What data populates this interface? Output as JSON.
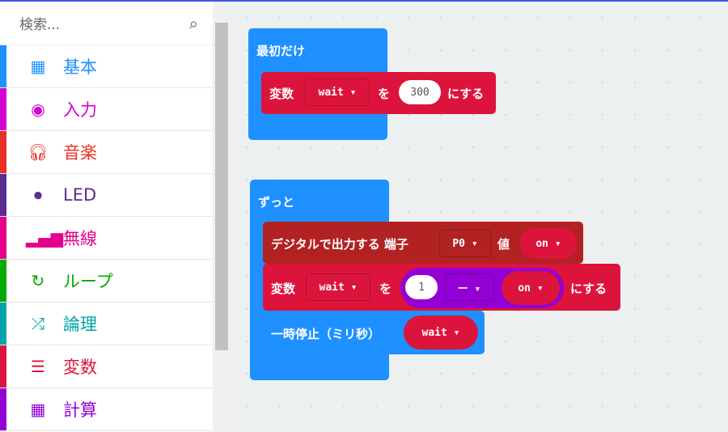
{
  "search": {
    "placeholder": "検索..."
  },
  "categories": [
    {
      "label": "基本",
      "icon": "grid-icon",
      "color": "#1e90ff"
    },
    {
      "label": "入力",
      "icon": "target-icon",
      "color": "#d400d4"
    },
    {
      "label": "音楽",
      "icon": "headphones-icon",
      "color": "#e63022"
    },
    {
      "label": "LED",
      "icon": "toggle-icon",
      "color": "#5c2d91"
    },
    {
      "label": "無線",
      "icon": "signal-icon",
      "color": "#e3008c"
    },
    {
      "label": "ループ",
      "icon": "refresh-icon",
      "color": "#00aa00"
    },
    {
      "label": "論理",
      "icon": "shuffle-icon",
      "color": "#00a4a6"
    },
    {
      "label": "変数",
      "icon": "list-icon",
      "color": "#dc143c"
    },
    {
      "label": "計算",
      "icon": "calculator-icon",
      "color": "#9400d3"
    }
  ],
  "blocks": {
    "on_start": {
      "label": "最初だけ",
      "set_label": "変数",
      "var": "wait ▾",
      "to": "を",
      "value": "300",
      "suffix": "にする"
    },
    "forever": {
      "label": "ずっと",
      "digital": {
        "label": "デジタルで出力する 端子",
        "pin": "P0 ▾",
        "val_label": "値",
        "val": "on ▾"
      },
      "set": {
        "label": "変数",
        "var": "wait ▾",
        "to": "を",
        "num": "1",
        "op": "ー ▾",
        "rhs": "on ▾",
        "suffix": "にする"
      },
      "pause": {
        "label": "一時停止（ミリ秒）",
        "var": "wait ▾"
      }
    }
  }
}
